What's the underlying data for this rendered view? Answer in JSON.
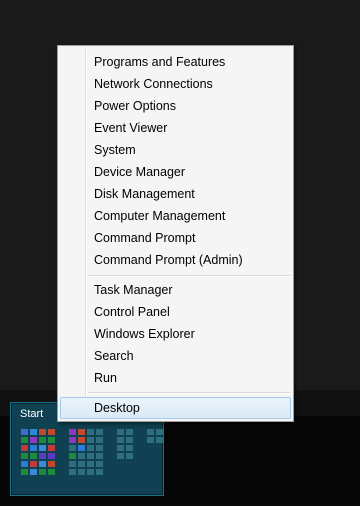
{
  "menu": {
    "group1": [
      "Programs and Features",
      "Network Connections",
      "Power Options",
      "Event Viewer",
      "System",
      "Device Manager",
      "Disk Management",
      "Computer Management",
      "Command Prompt",
      "Command Prompt (Admin)"
    ],
    "group2": [
      "Task Manager",
      "Control Panel",
      "Windows Explorer",
      "Search",
      "Run"
    ],
    "group3": [
      "Desktop"
    ]
  },
  "start": {
    "label": "Start"
  },
  "colors": {
    "menu_bg": "#f5f5f5",
    "highlight": "#dbeaf7",
    "start_tile": "#0f4152"
  }
}
